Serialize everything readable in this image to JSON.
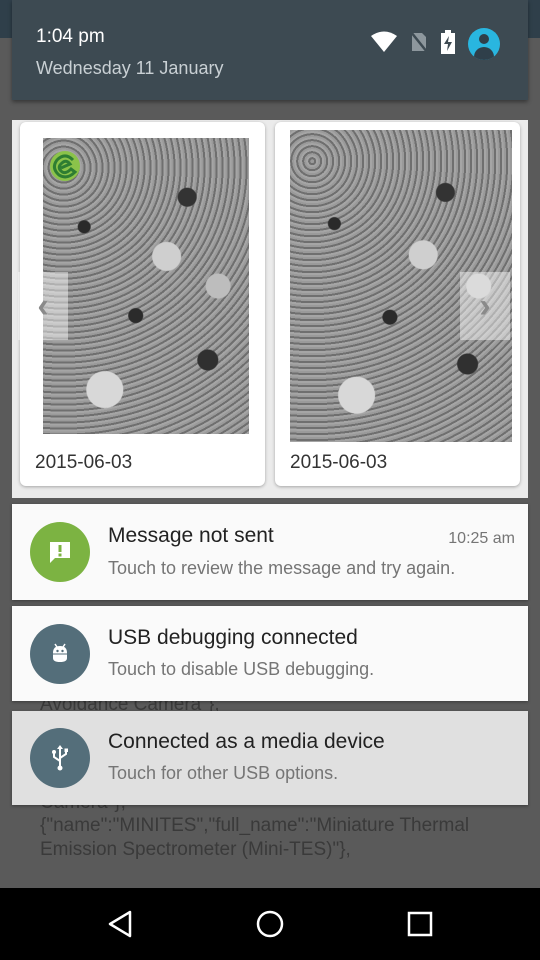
{
  "status": {
    "time": "1:04 pm",
    "date": "Wednesday 11 January",
    "icons": [
      "wifi-icon",
      "no-sim-icon",
      "battery-charging-icon",
      "account-icon"
    ]
  },
  "background_app": {
    "lines": [
      "Avoidance Camera\"},",
      "Camera\"},",
      "{\"name\":\"MINITES\",\"full_name\":\"Miniature Thermal",
      "Emission Spectrometer (Mini-TES)\"},"
    ]
  },
  "carousel": {
    "cards": [
      {
        "date": "2015-06-03"
      },
      {
        "date": "2015-06-03"
      }
    ],
    "prev_icon": "chevron-left-icon",
    "next_icon": "chevron-right-icon"
  },
  "notifications": [
    {
      "title": "Message not sent",
      "text": "Touch to review the message and try again.",
      "time": "10:25 am",
      "icon": "alert-message-icon",
      "icon_color": "#7cb342"
    },
    {
      "title": "USB debugging connected",
      "text": "Touch to disable USB debugging.",
      "icon": "android-debug-icon",
      "icon_color": "#546e7a"
    },
    {
      "title": "Connected as a media device",
      "text": "Touch for other USB options.",
      "icon": "usb-icon",
      "icon_color": "#546e7a"
    }
  ],
  "navbar": {
    "buttons": [
      "back-icon",
      "home-icon",
      "recents-icon"
    ]
  }
}
